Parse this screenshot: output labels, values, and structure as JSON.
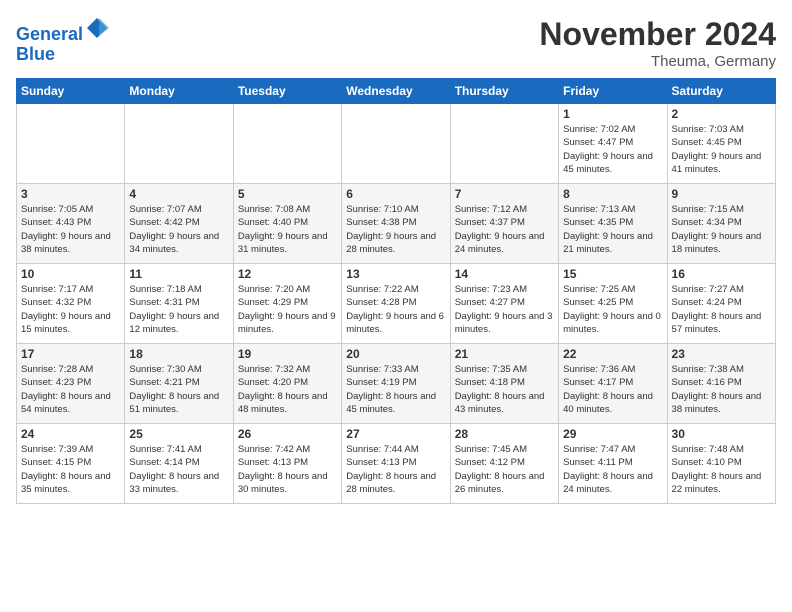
{
  "header": {
    "logo_line1": "General",
    "logo_line2": "Blue",
    "month": "November 2024",
    "location": "Theuma, Germany"
  },
  "days_of_week": [
    "Sunday",
    "Monday",
    "Tuesday",
    "Wednesday",
    "Thursday",
    "Friday",
    "Saturday"
  ],
  "weeks": [
    [
      {
        "day": "",
        "info": ""
      },
      {
        "day": "",
        "info": ""
      },
      {
        "day": "",
        "info": ""
      },
      {
        "day": "",
        "info": ""
      },
      {
        "day": "",
        "info": ""
      },
      {
        "day": "1",
        "info": "Sunrise: 7:02 AM\nSunset: 4:47 PM\nDaylight: 9 hours and 45 minutes."
      },
      {
        "day": "2",
        "info": "Sunrise: 7:03 AM\nSunset: 4:45 PM\nDaylight: 9 hours and 41 minutes."
      }
    ],
    [
      {
        "day": "3",
        "info": "Sunrise: 7:05 AM\nSunset: 4:43 PM\nDaylight: 9 hours and 38 minutes."
      },
      {
        "day": "4",
        "info": "Sunrise: 7:07 AM\nSunset: 4:42 PM\nDaylight: 9 hours and 34 minutes."
      },
      {
        "day": "5",
        "info": "Sunrise: 7:08 AM\nSunset: 4:40 PM\nDaylight: 9 hours and 31 minutes."
      },
      {
        "day": "6",
        "info": "Sunrise: 7:10 AM\nSunset: 4:38 PM\nDaylight: 9 hours and 28 minutes."
      },
      {
        "day": "7",
        "info": "Sunrise: 7:12 AM\nSunset: 4:37 PM\nDaylight: 9 hours and 24 minutes."
      },
      {
        "day": "8",
        "info": "Sunrise: 7:13 AM\nSunset: 4:35 PM\nDaylight: 9 hours and 21 minutes."
      },
      {
        "day": "9",
        "info": "Sunrise: 7:15 AM\nSunset: 4:34 PM\nDaylight: 9 hours and 18 minutes."
      }
    ],
    [
      {
        "day": "10",
        "info": "Sunrise: 7:17 AM\nSunset: 4:32 PM\nDaylight: 9 hours and 15 minutes."
      },
      {
        "day": "11",
        "info": "Sunrise: 7:18 AM\nSunset: 4:31 PM\nDaylight: 9 hours and 12 minutes."
      },
      {
        "day": "12",
        "info": "Sunrise: 7:20 AM\nSunset: 4:29 PM\nDaylight: 9 hours and 9 minutes."
      },
      {
        "day": "13",
        "info": "Sunrise: 7:22 AM\nSunset: 4:28 PM\nDaylight: 9 hours and 6 minutes."
      },
      {
        "day": "14",
        "info": "Sunrise: 7:23 AM\nSunset: 4:27 PM\nDaylight: 9 hours and 3 minutes."
      },
      {
        "day": "15",
        "info": "Sunrise: 7:25 AM\nSunset: 4:25 PM\nDaylight: 9 hours and 0 minutes."
      },
      {
        "day": "16",
        "info": "Sunrise: 7:27 AM\nSunset: 4:24 PM\nDaylight: 8 hours and 57 minutes."
      }
    ],
    [
      {
        "day": "17",
        "info": "Sunrise: 7:28 AM\nSunset: 4:23 PM\nDaylight: 8 hours and 54 minutes."
      },
      {
        "day": "18",
        "info": "Sunrise: 7:30 AM\nSunset: 4:21 PM\nDaylight: 8 hours and 51 minutes."
      },
      {
        "day": "19",
        "info": "Sunrise: 7:32 AM\nSunset: 4:20 PM\nDaylight: 8 hours and 48 minutes."
      },
      {
        "day": "20",
        "info": "Sunrise: 7:33 AM\nSunset: 4:19 PM\nDaylight: 8 hours and 45 minutes."
      },
      {
        "day": "21",
        "info": "Sunrise: 7:35 AM\nSunset: 4:18 PM\nDaylight: 8 hours and 43 minutes."
      },
      {
        "day": "22",
        "info": "Sunrise: 7:36 AM\nSunset: 4:17 PM\nDaylight: 8 hours and 40 minutes."
      },
      {
        "day": "23",
        "info": "Sunrise: 7:38 AM\nSunset: 4:16 PM\nDaylight: 8 hours and 38 minutes."
      }
    ],
    [
      {
        "day": "24",
        "info": "Sunrise: 7:39 AM\nSunset: 4:15 PM\nDaylight: 8 hours and 35 minutes."
      },
      {
        "day": "25",
        "info": "Sunrise: 7:41 AM\nSunset: 4:14 PM\nDaylight: 8 hours and 33 minutes."
      },
      {
        "day": "26",
        "info": "Sunrise: 7:42 AM\nSunset: 4:13 PM\nDaylight: 8 hours and 30 minutes."
      },
      {
        "day": "27",
        "info": "Sunrise: 7:44 AM\nSunset: 4:13 PM\nDaylight: 8 hours and 28 minutes."
      },
      {
        "day": "28",
        "info": "Sunrise: 7:45 AM\nSunset: 4:12 PM\nDaylight: 8 hours and 26 minutes."
      },
      {
        "day": "29",
        "info": "Sunrise: 7:47 AM\nSunset: 4:11 PM\nDaylight: 8 hours and 24 minutes."
      },
      {
        "day": "30",
        "info": "Sunrise: 7:48 AM\nSunset: 4:10 PM\nDaylight: 8 hours and 22 minutes."
      }
    ]
  ]
}
